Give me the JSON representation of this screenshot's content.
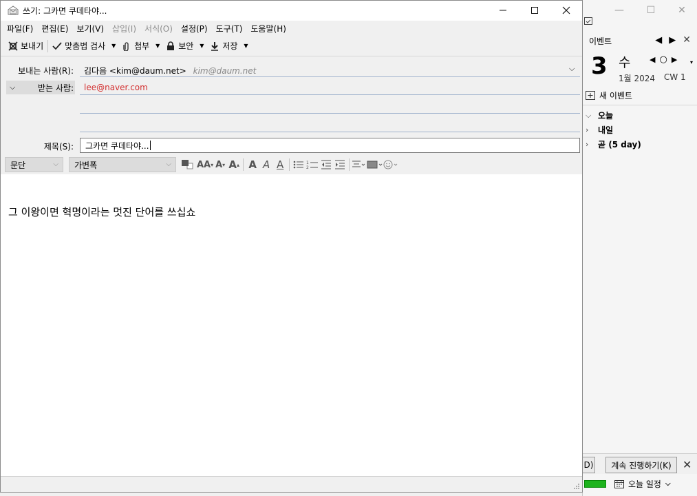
{
  "compose": {
    "title": "쓰기: 그카면 쿠데타야...",
    "controls": {
      "minimize": "—",
      "maximize": "☐",
      "close": "✕"
    },
    "menu": [
      {
        "label": "파일(F)",
        "disabled": false
      },
      {
        "label": "편집(E)",
        "disabled": false
      },
      {
        "label": "보기(V)",
        "disabled": false
      },
      {
        "label": "삽입(I)",
        "disabled": true
      },
      {
        "label": "서식(O)",
        "disabled": true
      },
      {
        "label": "설정(P)",
        "disabled": false
      },
      {
        "label": "도구(T)",
        "disabled": false
      },
      {
        "label": "도움말(H)",
        "disabled": false
      }
    ],
    "toolbar": {
      "send": "보내기",
      "spell": "맞춤법 검사",
      "attach": "첨부",
      "security": "보안",
      "save": "저장"
    },
    "headers": {
      "from_label": "보내는 사람(R):",
      "from_value": "김다음 <kim@daum.net>",
      "from_hint": "kim@daum.net",
      "to_label": "받는 사람:",
      "to_value": "lee@naver.com",
      "subject_label": "제목(S):",
      "subject_value": "그카면 쿠데타야..."
    },
    "format": {
      "paragraph": "문단",
      "font": "가변폭"
    },
    "body_text": "그 이왕이면 혁명이라는 멋진 단어를 쓰십쇼"
  },
  "calendar": {
    "header_label": "이벤트",
    "day_number": "3",
    "weekday": "수",
    "month_year": "1월 2024",
    "week": "CW 1",
    "new_event": "새 이벤트",
    "agenda": [
      {
        "label": "오늘",
        "expanded": true
      },
      {
        "label": "내일",
        "expanded": false
      },
      {
        "label": "곧 (5 day)",
        "expanded": false
      }
    ]
  },
  "notification": {
    "dismiss_short": "D)",
    "continue_label": "계속 진행하기(K)"
  },
  "status": {
    "today_pane": "오늘 일정"
  },
  "colors": {
    "to_address": "#d32f2f",
    "progress": "#1db31d"
  }
}
